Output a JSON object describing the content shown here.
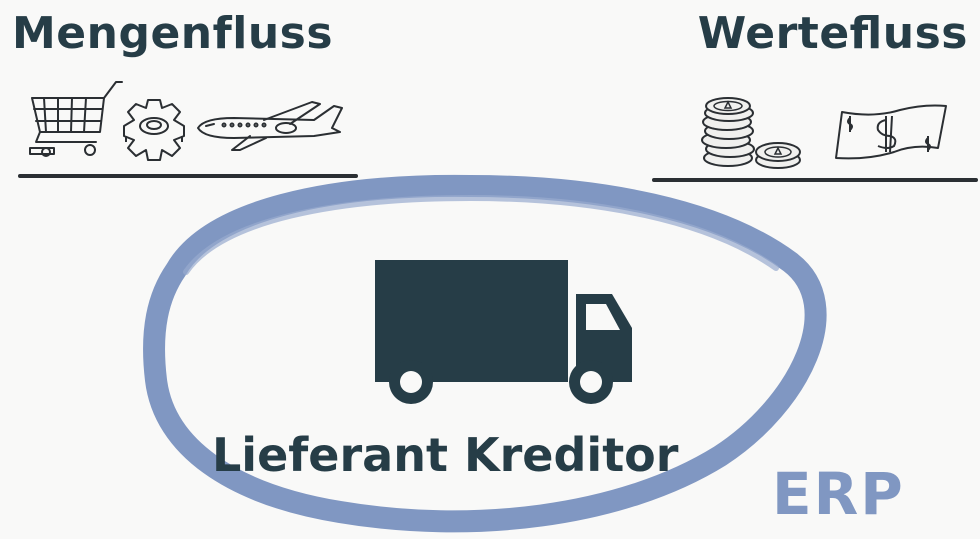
{
  "headings": {
    "left": "Mengenfluss",
    "right": "Werteﬂuss"
  },
  "main": {
    "caption": "Lieferant Kreditor",
    "erp_label": "ERP"
  },
  "icons": {
    "left": [
      "shopping-cart-icon",
      "gear-icon",
      "airplane-icon"
    ],
    "right": [
      "coin-stack-icon",
      "banknote-icon"
    ],
    "center": "truck-icon"
  },
  "colors": {
    "text": "#263d47",
    "ellipse": "#8097c2",
    "truck": "#263d47"
  }
}
